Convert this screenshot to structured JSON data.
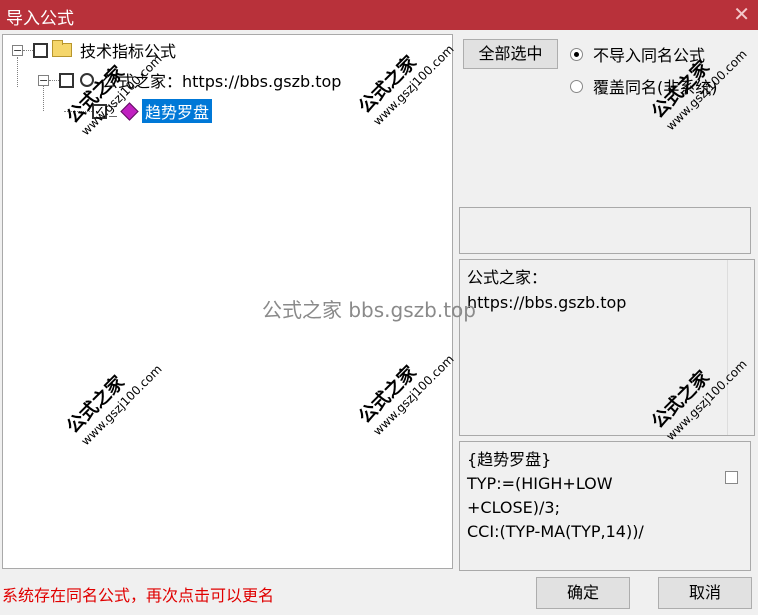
{
  "window": {
    "title": "导入公式",
    "close_glyph": "✕"
  },
  "tree": {
    "root": {
      "label": "技术指标公式",
      "expander": "−"
    },
    "child": {
      "label": "公式之家：https://bbs.gszb.top",
      "expander": "−"
    },
    "leaf": {
      "label": "趋势罗盘",
      "checked": "✓"
    }
  },
  "buttons": {
    "select_all": "全部选中",
    "ok": "确定",
    "cancel": "取消"
  },
  "options": {
    "no_import": "不导入同名公式",
    "overwrite": "覆盖同名(非系统)",
    "selected": "no_import"
  },
  "info": {
    "line1": "公式之家：",
    "line2": "https://bbs.gszb.top"
  },
  "code": {
    "line1": "{趋势罗盘}",
    "line2": "TYP:=(HIGH+LOW",
    "line3": "+CLOSE)/3;",
    "line4": "CCI:(TYP-MA(TYP,14))/"
  },
  "status": "系统存在同名公式，再次点击可以更名",
  "watermark": {
    "cn": "公式之家",
    "url": "www.gszj100.com",
    "center": "公式之家 bbs.gszb.top"
  }
}
